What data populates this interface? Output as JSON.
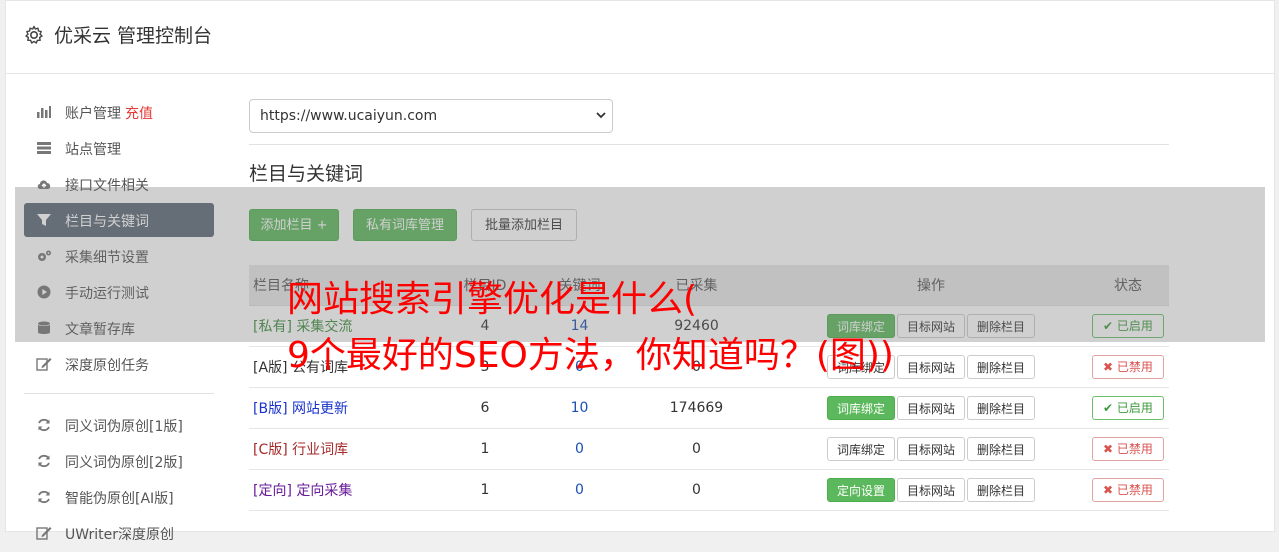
{
  "header": {
    "title": "优采云 管理控制台"
  },
  "sidebar": {
    "items": [
      {
        "label": "账户管理",
        "badge": "充值",
        "icon": "bar-chart-icon"
      },
      {
        "label": "站点管理",
        "icon": "server-icon"
      },
      {
        "label": "接口文件相关",
        "icon": "cloud-upload-icon"
      },
      {
        "label": "栏目与关键词",
        "icon": "filter-icon",
        "active": true
      },
      {
        "label": "采集细节设置",
        "icon": "cogs-icon"
      },
      {
        "label": "手动运行测试",
        "icon": "play-circle-icon"
      },
      {
        "label": "文章暂存库",
        "icon": "database-icon"
      },
      {
        "label": "深度原创任务",
        "icon": "edit-icon"
      }
    ],
    "items2": [
      {
        "label": "同义词伪原创[1版]",
        "icon": "refresh-icon"
      },
      {
        "label": "同义词伪原创[2版]",
        "icon": "refresh-icon"
      },
      {
        "label": "智能伪原创[AI版]",
        "icon": "refresh-icon"
      },
      {
        "label": "UWriter深度原创",
        "icon": "edit-icon"
      }
    ]
  },
  "main": {
    "site_select": "https://www.ucaiyun.com",
    "section_title": "栏目与关键词",
    "buttons": {
      "add": "添加栏目 +",
      "private_lib": "私有词库管理",
      "batch_add": "批量添加栏目"
    },
    "table": {
      "headers": [
        "栏目名称",
        "栏目ID",
        "关键词",
        "已采集",
        "操作",
        "状态"
      ],
      "rows": [
        {
          "tag": "[私有]",
          "name": "采集交流",
          "id": "4",
          "kw": "14",
          "count": "92460",
          "op1": "词库绑定",
          "op1_green": true,
          "op2": "目标网站",
          "op3": "删除栏目",
          "status": "已启用",
          "enabled": true,
          "color": "#3c8d3c"
        },
        {
          "tag": "[A版]",
          "name": "公有词库",
          "id": "3",
          "kw": "0",
          "count": "0",
          "op1": "词库绑定",
          "op1_green": false,
          "op2": "目标网站",
          "op3": "删除栏目",
          "status": "已禁用",
          "enabled": false,
          "color": "#333333"
        },
        {
          "tag": "[B版]",
          "name": "网站更新",
          "id": "6",
          "kw": "10",
          "count": "174669",
          "op1": "词库绑定",
          "op1_green": true,
          "op2": "目标网站",
          "op3": "删除栏目",
          "status": "已启用",
          "enabled": true,
          "color": "#1a33cc"
        },
        {
          "tag": "[C版]",
          "name": "行业词库",
          "id": "1",
          "kw": "0",
          "count": "0",
          "op1": "词库绑定",
          "op1_green": false,
          "op2": "目标网站",
          "op3": "删除栏目",
          "status": "已禁用",
          "enabled": false,
          "color": "#a52a2a"
        },
        {
          "tag": "[定向]",
          "name": "定向采集",
          "id": "1",
          "kw": "0",
          "count": "0",
          "op1": "定向设置",
          "op1_green": true,
          "op2": "目标网站",
          "op3": "删除栏目",
          "status": "已禁用",
          "enabled": false,
          "color": "#6a1b9a"
        }
      ]
    }
  },
  "overlay": {
    "headline_line1": "网站搜索引擎优化是什么(",
    "headline_line2": "9个最好的SEO方法，你知道吗？(图))"
  }
}
